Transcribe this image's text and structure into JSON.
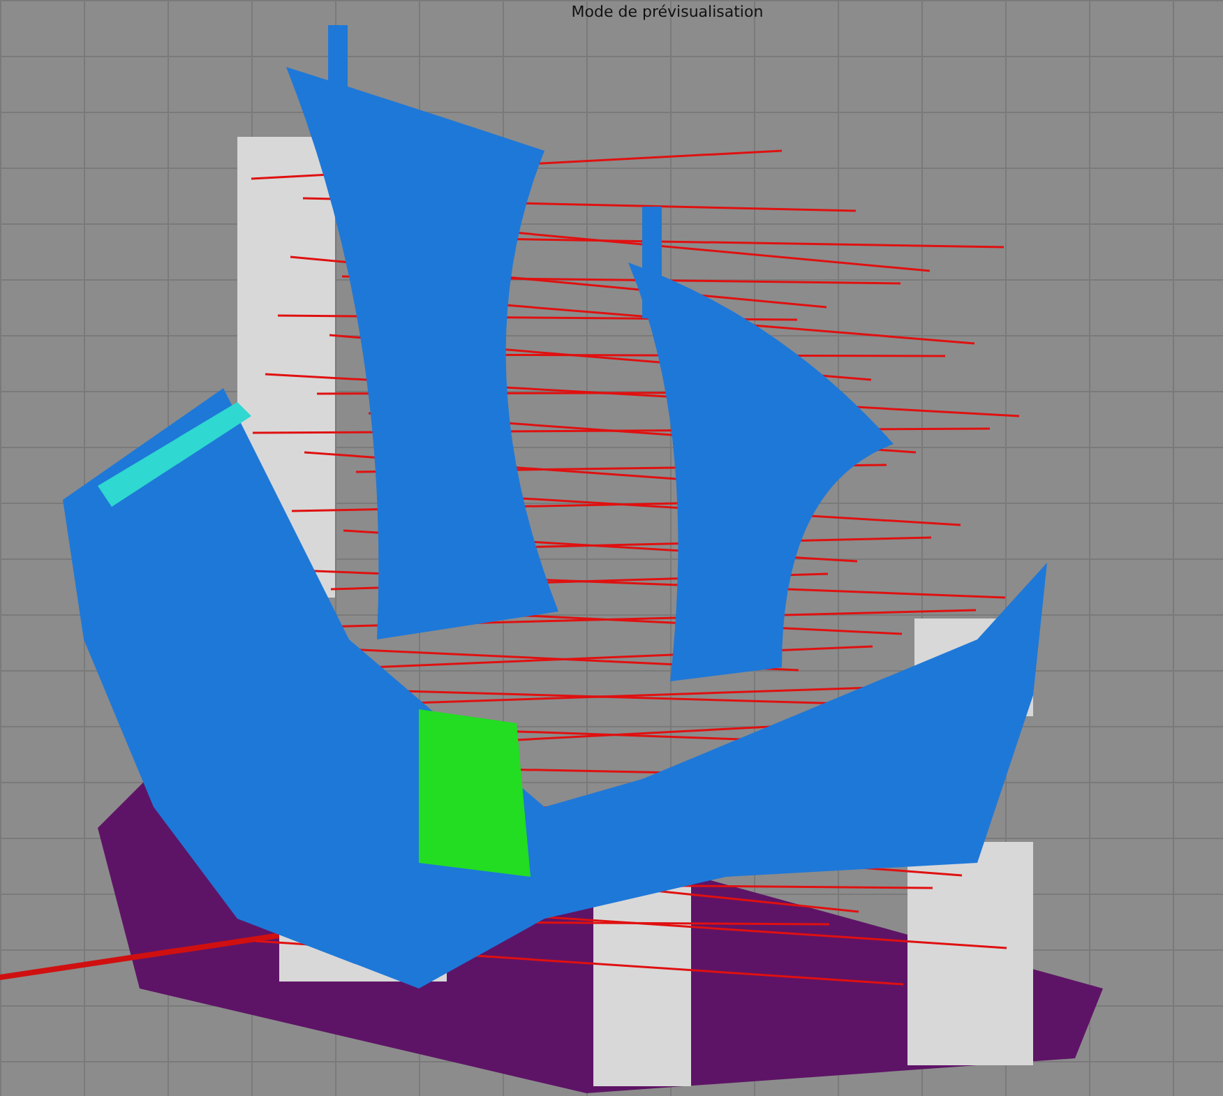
{
  "viewport": {
    "title": "Mode de prévisualisation"
  }
}
